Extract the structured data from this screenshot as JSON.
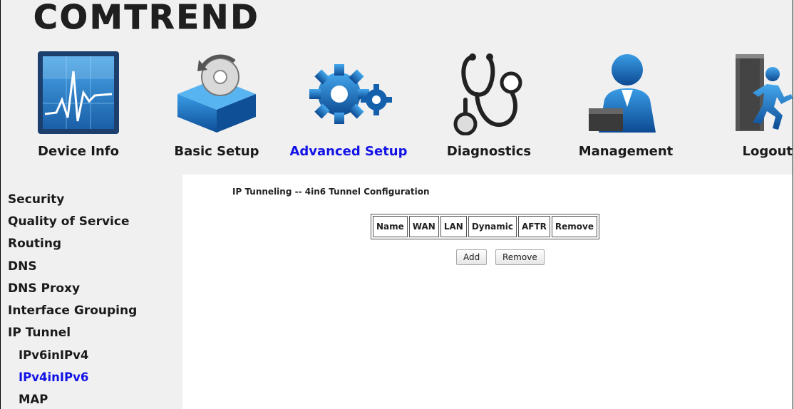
{
  "header": {
    "logo": "COMTREND",
    "nav": [
      {
        "label": "Device Info",
        "icon": "device-info-icon"
      },
      {
        "label": "Basic Setup",
        "icon": "basic-setup-icon"
      },
      {
        "label": "Advanced Setup",
        "icon": "advanced-setup-icon",
        "active": true
      },
      {
        "label": "Diagnostics",
        "icon": "diagnostics-icon"
      },
      {
        "label": "Management",
        "icon": "management-icon"
      },
      {
        "label": "Logout",
        "icon": "logout-icon"
      }
    ]
  },
  "sidebar": {
    "items": [
      {
        "label": "Security"
      },
      {
        "label": "Quality of Service"
      },
      {
        "label": "Routing"
      },
      {
        "label": "DNS"
      },
      {
        "label": "DNS Proxy"
      },
      {
        "label": "Interface Grouping"
      },
      {
        "label": "IP Tunnel"
      },
      {
        "label": "IPv6inIPv4"
      },
      {
        "label": "IPv4inIPv6",
        "active": true
      },
      {
        "label": "MAP"
      }
    ]
  },
  "main": {
    "title": "IP Tunneling -- 4in6 Tunnel Configuration",
    "table": {
      "columns": [
        "Name",
        "WAN",
        "LAN",
        "Dynamic",
        "AFTR",
        "Remove"
      ],
      "rows": []
    },
    "buttons": {
      "add": "Add",
      "remove": "Remove"
    }
  },
  "colors": {
    "active_link": "#1212e6",
    "panel_background": "#f0f0f0"
  }
}
